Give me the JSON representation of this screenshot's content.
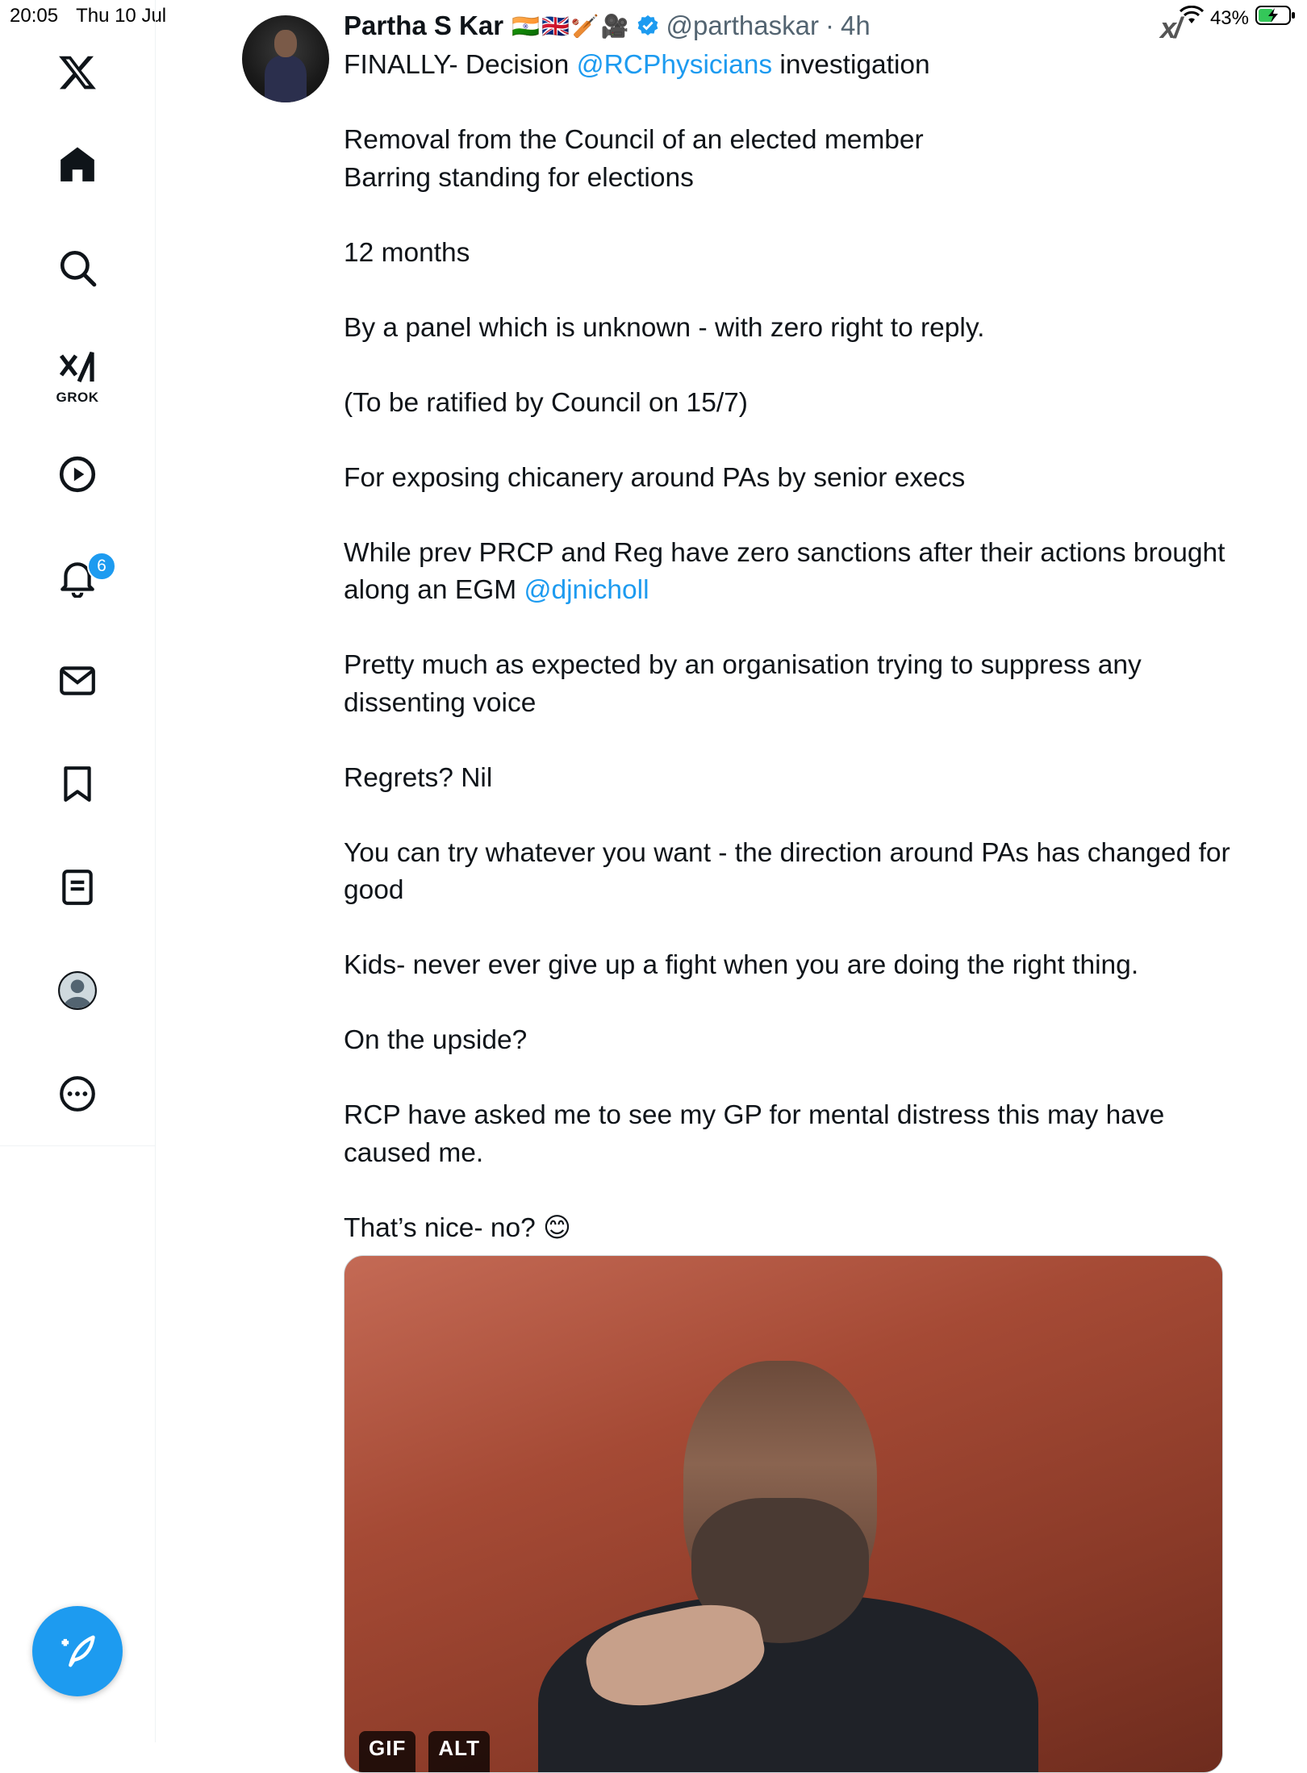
{
  "status_bar": {
    "time": "20:05",
    "date": "Thu 10 Jul",
    "battery": "43%"
  },
  "sidebar": {
    "grok_label": "GROK",
    "notification_count": "6",
    "icons": [
      "x-logo-icon",
      "home-icon",
      "search-icon",
      "grok-icon",
      "video-icon",
      "notifications-icon",
      "messages-icon",
      "bookmarks-icon",
      "lists-icon",
      "profile-icon",
      "more-icon"
    ]
  },
  "tweet": {
    "display_name": "Partha S Kar",
    "name_emojis": "🇮🇳🇬🇧🏏🎥",
    "handle": "@parthaskar",
    "separator": "·",
    "time": "4h",
    "line1_pre": "FINALLY- Decision ",
    "line1_mention": "@RCPhysicians",
    "line1_post": " investigation",
    "p2_line1": "Removal from the Council of an elected member",
    "p2_line2": "Barring standing for elections",
    "p3": "12 months",
    "p4": "By a panel which is unknown - with zero right to reply.",
    "p5": "(To be ratified by Council on 15/7)",
    "p6": "For exposing chicanery around PAs by senior execs",
    "p7_pre": "While prev PRCP and Reg have zero sanctions after their actions brought along an EGM ",
    "p7_mention": "@djnicholl",
    "p8": "Pretty much as expected by an organisation trying to suppress any dissenting voice",
    "p9": "Regrets? Nil",
    "p10": "You can try whatever you want - the direction around PAs has changed for good",
    "p11": "Kids- never ever give up a fight when you are doing the right thing.",
    "p12": "On the upside?",
    "p13": "RCP have asked me to see my GP for mental distress this may have caused me.",
    "p14": "That’s nice- no? 😊"
  },
  "media": {
    "badge_gif": "GIF",
    "badge_alt": "ALT"
  },
  "colors": {
    "accent": "#1d9bf0",
    "text": "#0f1419",
    "muted": "#536471"
  }
}
